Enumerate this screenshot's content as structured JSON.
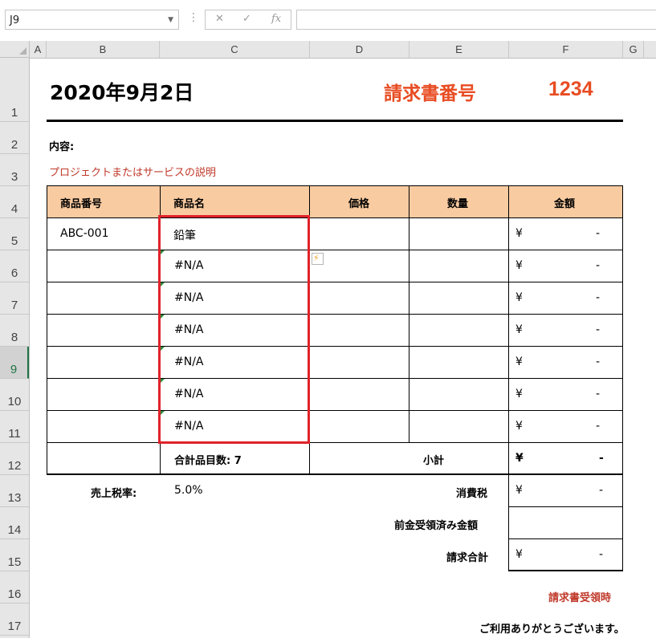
{
  "formula_bar": {
    "name_box": "J9",
    "cancel_icon": "✕",
    "enter_icon": "✓",
    "fx_label": "fx",
    "formula": ""
  },
  "columns": [
    "A",
    "B",
    "C",
    "D",
    "E",
    "F",
    "G"
  ],
  "rows": [
    "1",
    "2",
    "3",
    "4",
    "5",
    "6",
    "7",
    "8",
    "9",
    "10",
    "11",
    "12",
    "13",
    "14",
    "15",
    "16",
    "17"
  ],
  "selected_row": "9",
  "invoice": {
    "date": "2020年9月2日",
    "number_label": "請求書番号",
    "number": "1234",
    "content_label": "内容:",
    "content_desc": "プロジェクトまたはサービスの説明",
    "headers": [
      "商品番号",
      "商品名",
      "価格",
      "数量",
      "金額"
    ],
    "items": [
      {
        "code": "ABC-001",
        "name": "鉛筆",
        "yen": "¥",
        "amount": "-"
      },
      {
        "code": "",
        "name": "#N/A",
        "yen": "¥",
        "amount": "-"
      },
      {
        "code": "",
        "name": "#N/A",
        "yen": "¥",
        "amount": "-"
      },
      {
        "code": "",
        "name": "#N/A",
        "yen": "¥",
        "amount": "-"
      },
      {
        "code": "",
        "name": "#N/A",
        "yen": "¥",
        "amount": "-"
      },
      {
        "code": "",
        "name": "#N/A",
        "yen": "¥",
        "amount": "-"
      },
      {
        "code": "",
        "name": "#N/A",
        "yen": "¥",
        "amount": "-"
      }
    ],
    "item_count": "合計品目数: 7",
    "subtotal_label": "小計",
    "subtotal_yen": "¥",
    "subtotal_amount": "-",
    "tax_rate_label": "売上税率:",
    "tax_rate": "5.0%",
    "tax_label": "消費税",
    "tax_yen": "¥",
    "tax_amount": "-",
    "prepaid_label": "前金受領済み金額",
    "total_label": "請求合計",
    "total_yen": "¥",
    "total_amount": "-",
    "receipt_label": "請求書受領時",
    "thanks": "ご利用ありがとうございます。"
  },
  "colors": {
    "header_fill": "#f9cba1",
    "accent_orange": "#e84c22",
    "accent_red": "#c0392b",
    "highlight_box": "#e0232b",
    "excel_green": "#217346"
  }
}
